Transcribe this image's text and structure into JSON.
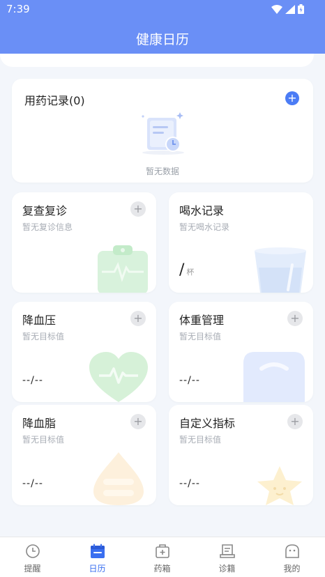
{
  "status": {
    "time": "7:39"
  },
  "header": {
    "title": "健康日历"
  },
  "medication": {
    "title": "用药记录(0)",
    "empty_text": "暂无数据"
  },
  "cards": {
    "followup": {
      "title": "复查复诊",
      "subtitle": "暂无复诊信息"
    },
    "water": {
      "title": "喝水记录",
      "subtitle": "暂无喝水记录",
      "value": "/",
      "unit": "杯"
    },
    "blood_pressure": {
      "title": "降血压",
      "subtitle": "暂无目标值",
      "value": "--/--"
    },
    "weight": {
      "title": "体重管理",
      "subtitle": "暂无目标值",
      "value": "--/--"
    },
    "blood_lipid": {
      "title": "降血脂",
      "subtitle": "暂无目标值",
      "value": "--/--"
    },
    "custom": {
      "title": "自定义指标",
      "subtitle": "暂无目标值",
      "value": "--/--"
    }
  },
  "tabs": [
    {
      "label": "提醒",
      "icon": "clock-icon",
      "active": false
    },
    {
      "label": "日历",
      "icon": "calendar-icon",
      "active": true
    },
    {
      "label": "药箱",
      "icon": "medicine-box-icon",
      "active": false
    },
    {
      "label": "诊籍",
      "icon": "records-icon",
      "active": false
    },
    {
      "label": "我的",
      "icon": "profile-icon",
      "active": false
    }
  ],
  "colors": {
    "header": "#6a8ff6",
    "accent": "#3a6ff0",
    "background": "#f3f6fb"
  }
}
